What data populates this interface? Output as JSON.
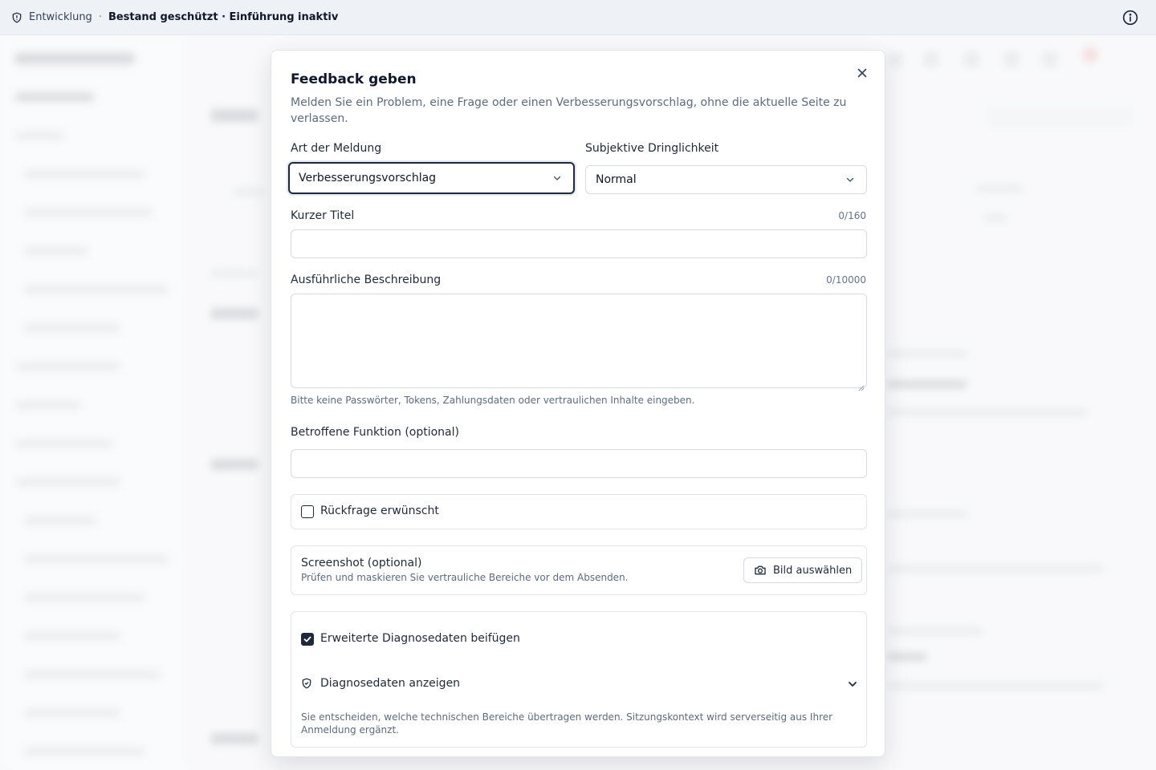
{
  "env_bar": {
    "environment": "Entwicklung",
    "separator": "·",
    "status": "Bestand geschützt · Einführung inaktiv"
  },
  "modal": {
    "title": "Feedback geben",
    "description": "Melden Sie ein Problem, eine Frage oder einen Verbesserungsvorschlag, ohne die aktuelle Seite zu verlassen.",
    "type_label": "Art der Meldung",
    "type_value": "Verbesserungsvorschlag",
    "urgency_label": "Subjektive Dringlichkeit",
    "urgency_value": "Normal",
    "title_field_label": "Kurzer Titel",
    "title_counter": "0/160",
    "title_value": "",
    "description_field_label": "Ausführliche Beschreibung",
    "description_counter": "0/10000",
    "description_value": "",
    "privacy_hint": "Bitte keine Passwörter, Tokens, Zahlungsdaten oder vertraulichen Inhalte eingeben.",
    "function_label": "Betroffene Funktion (optional)",
    "function_value": "",
    "callback_label": "Rückfrage erwünscht",
    "callback_checked": false,
    "screenshot_title": "Screenshot (optional)",
    "screenshot_hint": "Prüfen und maskieren Sie vertrauliche Bereiche vor dem Absenden.",
    "screenshot_button": "Bild auswählen",
    "diagnostics_label": "Erweiterte Diagnosedaten beifügen",
    "diagnostics_checked": true,
    "show_diagnostics_label": "Diagnosedaten anzeigen",
    "diagnostics_note": "Sie entscheiden, welche technischen Bereiche übertragen werden. Sitzungskontext wird serverseitig aus Ihrer Anmeldung ergänzt."
  },
  "icons": {
    "env": "shield-icon",
    "info": "info-icon",
    "close": "close-icon",
    "select": "chevron-down-icon",
    "camera": "camera-icon",
    "diagnostics": "shield-check-icon",
    "expand": "chevron-down-icon"
  },
  "colors": {
    "accent": "#1e293b",
    "muted_text": "#5b6b80",
    "border": "#d5dae1"
  }
}
